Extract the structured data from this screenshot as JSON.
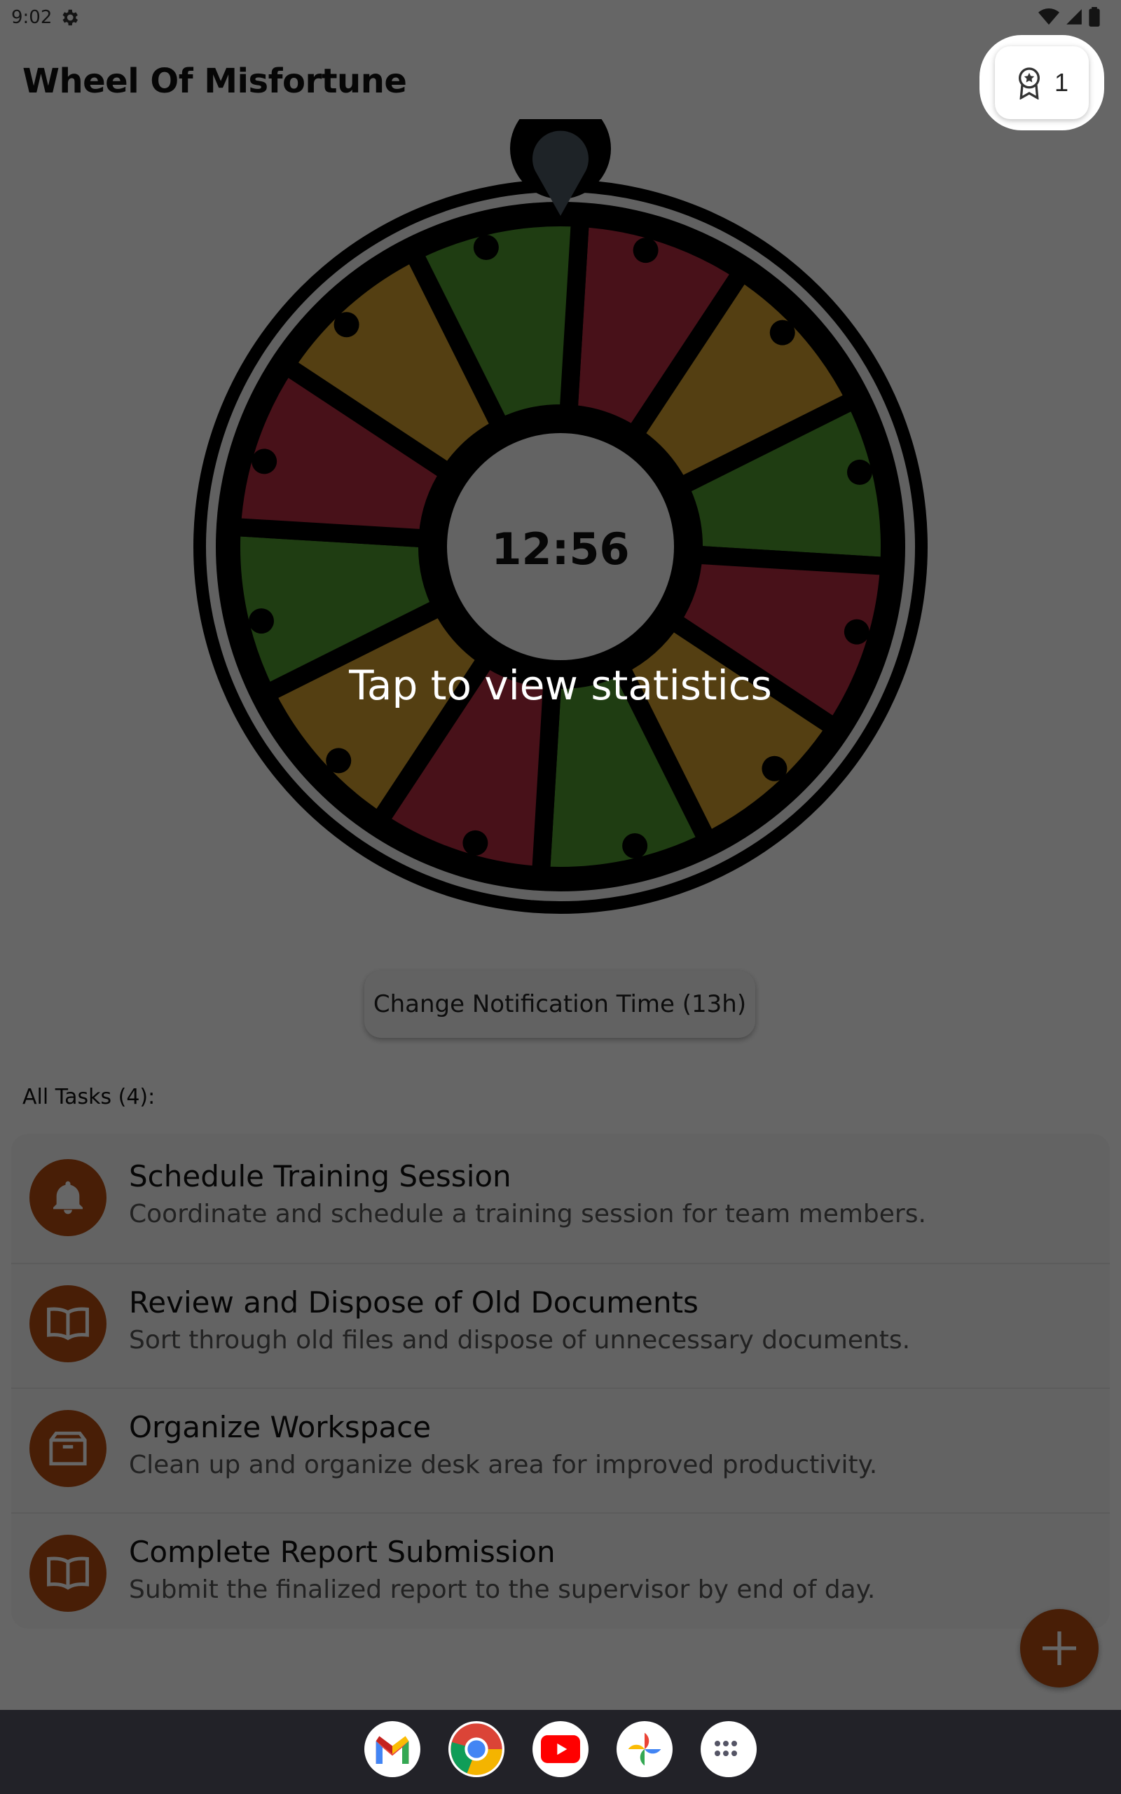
{
  "status_bar": {
    "time": "9:02"
  },
  "app": {
    "title": "Wheel Of Misfortune"
  },
  "badge": {
    "count": "1"
  },
  "wheel": {
    "timer": "12:56",
    "segment_colors": [
      "#b52b40",
      "#d39f2d",
      "#4f9a2e",
      "#b52b40",
      "#d39f2d",
      "#4f9a2e",
      "#b52b40",
      "#d39f2d",
      "#4f9a2e",
      "#b52b40",
      "#d39f2d",
      "#4f9a2e"
    ]
  },
  "overlay": {
    "hint": "Tap to view statistics"
  },
  "notification_button": {
    "label": "Change Notification Time (13h)"
  },
  "tasks": {
    "heading": "All Tasks (4):",
    "items": [
      {
        "title": "Schedule Training Session",
        "description": "Coordinate and schedule a training session for team members.",
        "icon": "bell-icon"
      },
      {
        "title": "Review and Dispose of Old Documents",
        "description": "Sort through old files and dispose of unnecessary documents.",
        "icon": "book-icon"
      },
      {
        "title": "Organize Workspace",
        "description": "Clean up and organize desk area for improved productivity.",
        "icon": "box-icon"
      },
      {
        "title": "Complete Report Submission",
        "description": "Submit the finalized report to the supervisor by end of day.",
        "icon": "book-icon"
      }
    ]
  },
  "colors": {
    "accent": "#b34b0f",
    "scrim": "rgba(0,0,0,0.6)"
  },
  "dock": {
    "apps": [
      "gmail-icon",
      "chrome-icon",
      "youtube-icon",
      "photos-icon",
      "app-drawer-icon"
    ]
  }
}
